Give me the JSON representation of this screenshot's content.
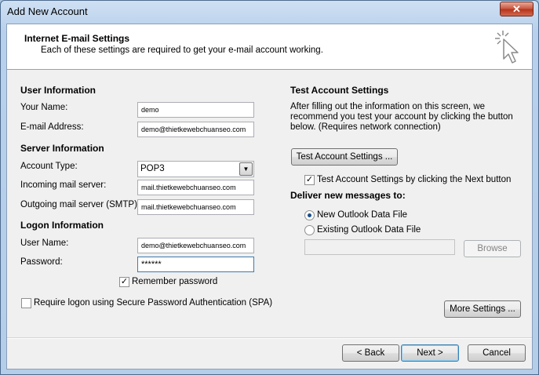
{
  "window": {
    "title": "Add New Account",
    "close_label": "✕"
  },
  "header": {
    "title": "Internet E-mail Settings",
    "subtitle": "Each of these settings are required to get your e-mail account working."
  },
  "user_info": {
    "heading": "User Information",
    "your_name_label": "Your Name:",
    "your_name_value": "demo",
    "email_label": "E-mail Address:",
    "email_value": "demo@thietkewebchuanseo.com"
  },
  "server_info": {
    "heading": "Server Information",
    "account_type_label": "Account Type:",
    "account_type_value": "POP3",
    "incoming_label": "Incoming mail server:",
    "incoming_value": "mail.thietkewebchuanseo.com",
    "outgoing_label": "Outgoing mail server (SMTP):",
    "outgoing_value": "mail.thietkewebchuanseo.com"
  },
  "logon_info": {
    "heading": "Logon Information",
    "username_label": "User Name:",
    "username_value": "demo@thietkewebchuanseo.com",
    "password_label": "Password:",
    "password_value": "******",
    "remember_label": "Remember password",
    "remember_checked": true,
    "spa_label": "Require logon using Secure Password Authentication (SPA)",
    "spa_checked": false
  },
  "test_settings": {
    "heading": "Test Account Settings",
    "description": "After filling out the information on this screen, we recommend you test your account by clicking the button below. (Requires network connection)",
    "button_label": "Test Account Settings ...",
    "next_check_label": "Test Account Settings by clicking the Next button",
    "next_check_checked": true
  },
  "deliver": {
    "heading": "Deliver new messages to:",
    "new_file_label": "New Outlook Data File",
    "new_file_selected": true,
    "existing_file_label": "Existing Outlook Data File",
    "existing_file_selected": false,
    "browse_label": "Browse"
  },
  "more_settings_label": "More Settings ...",
  "footer": {
    "back_label": "< Back",
    "next_label": "Next >",
    "cancel_label": "Cancel"
  },
  "icons": {
    "header_icon": "mouse-cursor-click-icon",
    "dropdown_icon": "chevron-down-icon",
    "check_icon": "checkmark-icon"
  }
}
